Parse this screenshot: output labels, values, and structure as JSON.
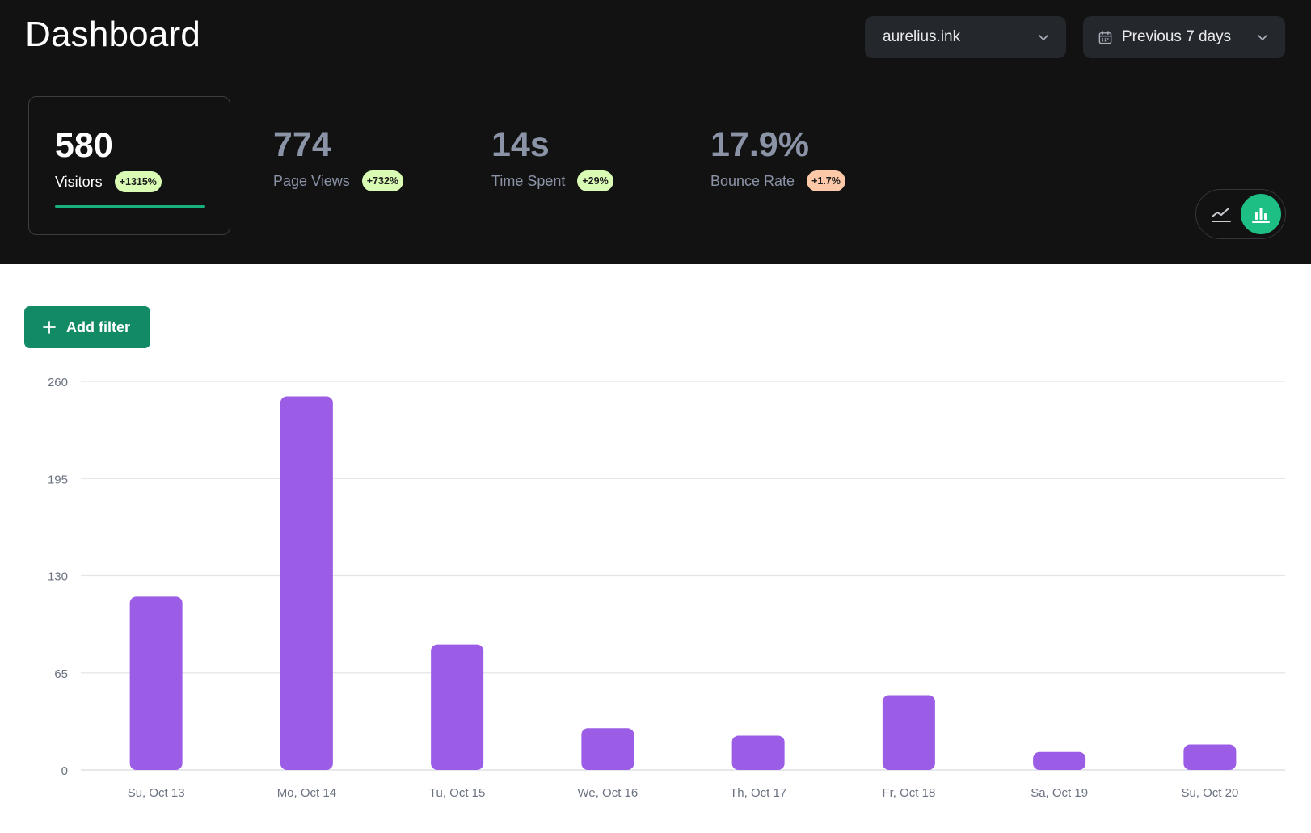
{
  "header": {
    "title": "Dashboard",
    "site_selector": {
      "value": "aurelius.ink",
      "icon": "chevron-down-icon"
    },
    "date_selector": {
      "value": "Previous 7 days",
      "icon": "calendar-icon"
    }
  },
  "metrics": [
    {
      "value": "580",
      "label": "Visitors",
      "change": "+1315%",
      "change_color": "#d9fbb4",
      "active": true
    },
    {
      "value": "774",
      "label": "Page Views",
      "change": "+732%",
      "change_color": "#d9fbb4",
      "active": false
    },
    {
      "value": "14s",
      "label": "Time Spent",
      "change": "+29%",
      "change_color": "#d9fbb4",
      "active": false
    },
    {
      "value": "17.9%",
      "label": "Bounce Rate",
      "change": "+1.7%",
      "change_color": "#fcc8a8",
      "active": false
    }
  ],
  "chart_toggle": {
    "options": [
      "line-chart-icon",
      "bar-chart-icon"
    ],
    "selected": "bar-chart-icon"
  },
  "filter": {
    "add_label": "Add filter"
  },
  "colors": {
    "accent": "#1dbf85",
    "bar": "#9b5de5",
    "header_bg": "#121212"
  },
  "chart_data": {
    "type": "bar",
    "categories": [
      "Su, Oct 13",
      "Mo, Oct 14",
      "Tu, Oct 15",
      "We, Oct 16",
      "Th, Oct 17",
      "Fr, Oct 18",
      "Sa, Oct 19",
      "Su, Oct 20"
    ],
    "values": [
      116,
      250,
      84,
      28,
      23,
      50,
      12,
      17
    ],
    "yticks": [
      0,
      65,
      130,
      195,
      260
    ],
    "ylim": [
      0,
      260
    ],
    "grid": true,
    "xlabel": "",
    "ylabel": ""
  }
}
